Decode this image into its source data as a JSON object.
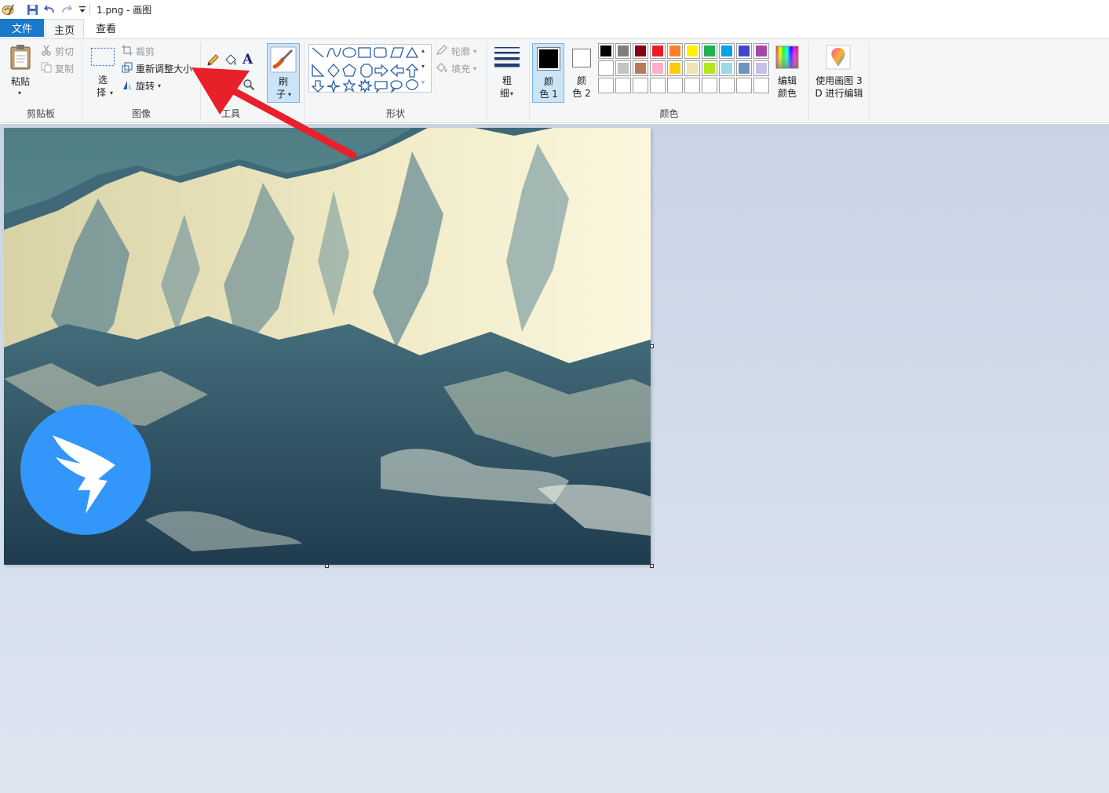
{
  "window": {
    "title": "1.png - 画图"
  },
  "tabs": {
    "file": "文件",
    "home": "主页",
    "view": "查看"
  },
  "clipboard": {
    "paste": "粘贴",
    "cut": "剪切",
    "copy": "复制",
    "group_label": "剪贴板"
  },
  "image": {
    "select_line1": "选",
    "select_line2": "择",
    "crop": "裁剪",
    "resize": "重新调整大小",
    "rotate": "旋转",
    "group_label": "图像"
  },
  "tools": {
    "group_label": "工具"
  },
  "brush": {
    "line1": "刷",
    "line2": "子"
  },
  "shapes": {
    "outline": "轮廓",
    "fill": "填充",
    "group_label": "形状"
  },
  "size": {
    "line1": "粗",
    "line2": "细"
  },
  "colors": {
    "color1_line1": "颜",
    "color1_line2": "色 1",
    "color2_line1": "颜",
    "color2_line2": "色 2",
    "edit_line1": "编辑",
    "edit_line2": "颜色",
    "group_label": "颜色",
    "color1_value": "#000000",
    "color2_value": "#ffffff",
    "palette_row1": [
      "#000000",
      "#7f7f7f",
      "#880015",
      "#ed1c24",
      "#ff7f27",
      "#fff200",
      "#22b14c",
      "#00a2e8",
      "#3f48cc",
      "#a349a4"
    ],
    "palette_row2": [
      "#ffffff",
      "#c3c3c3",
      "#b97a57",
      "#ffaec9",
      "#ffc90e",
      "#efe4b0",
      "#b5e61d",
      "#99d9ea",
      "#7092be",
      "#c8bfe7"
    ],
    "palette_row3": [
      "#ffffff",
      "#ffffff",
      "#ffffff",
      "#ffffff",
      "#ffffff",
      "#ffffff",
      "#ffffff",
      "#ffffff",
      "#ffffff",
      "#ffffff"
    ]
  },
  "paint3d": {
    "line1": "使用画图 3",
    "line2": "D 进行编辑"
  },
  "accent": {
    "file_tab": "#1979ca",
    "select_highlight": "#cce4f7",
    "arrow": "#e8202a",
    "logo": "#3296fa"
  }
}
